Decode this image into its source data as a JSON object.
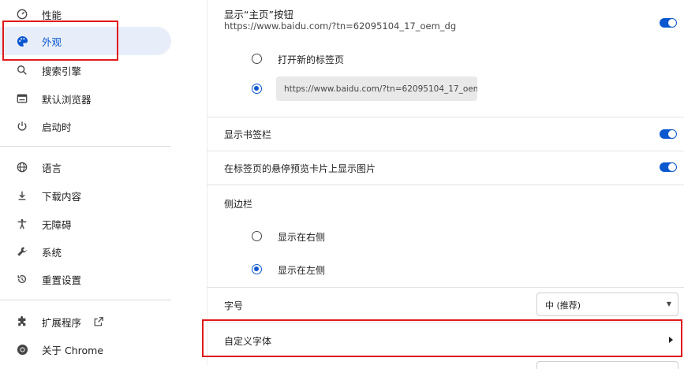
{
  "sidebar": {
    "items": [
      {
        "label": "性能",
        "icon": "performance-icon"
      },
      {
        "label": "外观",
        "icon": "palette-icon"
      },
      {
        "label": "搜索引擎",
        "icon": "search-icon"
      },
      {
        "label": "默认浏览器",
        "icon": "browser-icon"
      },
      {
        "label": "启动时",
        "icon": "power-icon"
      },
      {
        "label": "语言",
        "icon": "globe-icon"
      },
      {
        "label": "下载内容",
        "icon": "download-icon"
      },
      {
        "label": "无障碍",
        "icon": "accessibility-icon"
      },
      {
        "label": "系统",
        "icon": "wrench-icon"
      },
      {
        "label": "重置设置",
        "icon": "reset-icon"
      },
      {
        "label": "扩展程序",
        "icon": "puzzle-icon"
      },
      {
        "label": "关于 Chrome",
        "icon": "chrome-icon"
      }
    ],
    "external_link_icon": "open-in-new-icon"
  },
  "main": {
    "home_button": {
      "label": "显示“主页”按钮",
      "url": "https://www.baidu.com/?tn=62095104_17_oem_dg",
      "option_new_tab": "打开新的标签页",
      "custom_url_value": "https://www.baidu.com/?tn=62095104_17_oem..."
    },
    "bookmarks_bar_label": "显示书签栏",
    "hover_preview_label": "在标签页的悬停预览卡片上显示图片",
    "side_panel": {
      "label": "侧边栏",
      "option_right": "显示在右侧",
      "option_left": "显示在左侧"
    },
    "font_size": {
      "label": "字号",
      "value": "中 (推荐)"
    },
    "custom_fonts_label": "自定义字体"
  },
  "colors": {
    "accent": "#0b57d0",
    "highlight": "#e0191b",
    "selected_bg": "#e8eef9"
  }
}
